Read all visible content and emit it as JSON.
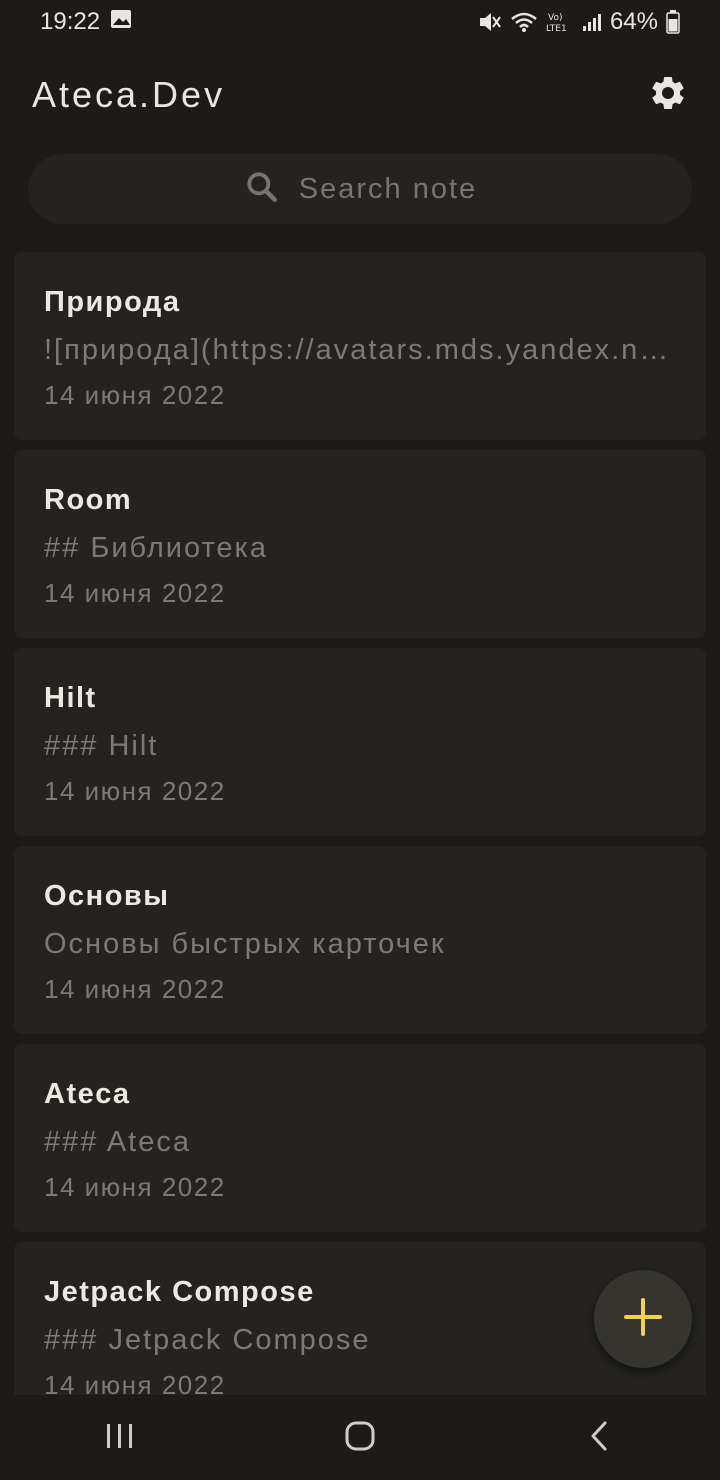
{
  "status_bar": {
    "time": "19:22",
    "battery": "64%"
  },
  "app_bar": {
    "title": "Ateca.Dev"
  },
  "search": {
    "placeholder": "Search note"
  },
  "notes": [
    {
      "title": "Природа",
      "body": "![природа](https://avatars.mds.yandex.net/",
      "date": "14 июня 2022"
    },
    {
      "title": "Room",
      "body": "## Библиотека",
      "date": "14 июня 2022"
    },
    {
      "title": "Hilt",
      "body": "### Hilt",
      "date": "14 июня 2022"
    },
    {
      "title": "Основы",
      "body": "Основы быстрых карточек",
      "date": "14 июня 2022"
    },
    {
      "title": "Ateca",
      "body": "###  Ateca",
      "date": "14 июня 2022"
    },
    {
      "title": "Jetpack Compose",
      "body": "### Jetpack Compose",
      "date": "14 июня 2022"
    }
  ],
  "colors": {
    "background": "#1c1b19",
    "card": "#242320",
    "fab_icon": "#f2d05a",
    "muted_text": "#7d7a74"
  },
  "icons": {
    "gallery": "image-icon",
    "mute": "mute-icon",
    "wifi": "wifi-icon",
    "volte": "volte-icon",
    "signal": "signal-icon",
    "battery": "battery-icon",
    "settings": "gear-icon",
    "search": "search-icon",
    "add": "plus-icon",
    "recents": "recents-icon",
    "home": "home-icon",
    "back": "back-icon"
  }
}
